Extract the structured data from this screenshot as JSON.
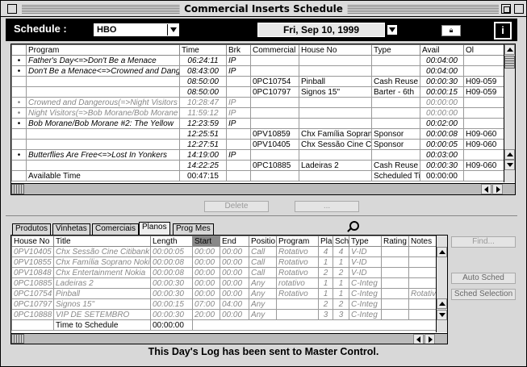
{
  "window": {
    "title": "Commercial Inserts Schedule"
  },
  "header": {
    "schedule_label": "Schedule :",
    "channel": "HBO",
    "date": "Fri, Sep 10, 1999"
  },
  "top_table": {
    "columns": [
      "",
      "Program",
      "Time",
      "Brk",
      "Commercial",
      "House No",
      "Type",
      "Avail",
      "Ol"
    ],
    "rows": [
      {
        "bullet": "•",
        "program": "Father's Day<=>Don't Be a Menace",
        "time": "06:24:11",
        "brk": "IP",
        "commercial": "",
        "house": "",
        "type": "",
        "avail": "00:04:00",
        "ol": "",
        "grey": false
      },
      {
        "bullet": "•",
        "program": "Don't Be a Menace<=>Crowned and Danger",
        "time": "08:43:00",
        "brk": "IP",
        "commercial": "",
        "house": "",
        "type": "",
        "avail": "00:04:00",
        "ol": "",
        "grey": false
      },
      {
        "bullet": "",
        "program": "",
        "time": "08:50:00",
        "brk": "",
        "commercial": "0PC10754",
        "house": "Pinball",
        "type": "Cash Reuse -",
        "avail": "00:00:30",
        "ol": "H09-059",
        "grey": false
      },
      {
        "bullet": "",
        "program": "",
        "time": "08:50:00",
        "brk": "",
        "commercial": "0PC10797",
        "house": "Signos 15\"",
        "type": "Barter - 6th",
        "avail": "00:00:15",
        "ol": "H09-059",
        "grey": false
      },
      {
        "bullet": "•",
        "program": "Crowned and Dangerous(=>Night Visitors",
        "time": "10:28:47",
        "brk": "IP",
        "commercial": "",
        "house": "",
        "type": "",
        "avail": "00:00:00",
        "ol": "",
        "grey": true
      },
      {
        "bullet": "•",
        "program": "Night Visitors(=>Bob Morane/Bob Morane",
        "time": "11:59:12",
        "brk": "IP",
        "commercial": "",
        "house": "",
        "type": "",
        "avail": "00:00:00",
        "ol": "",
        "grey": true
      },
      {
        "bullet": "•",
        "program": "Bob Morane/Bob Morane #2: The Yellow",
        "time": "12:23:59",
        "brk": "IP",
        "commercial": "",
        "house": "",
        "type": "",
        "avail": "00:02:00",
        "ol": "",
        "grey": false
      },
      {
        "bullet": "",
        "program": "",
        "time": "12:25:51",
        "brk": "",
        "commercial": "0PV10859",
        "house": "Chx Família Sopran",
        "type": "Sponsor",
        "avail": "00:00:08",
        "ol": "H09-060",
        "grey": false
      },
      {
        "bullet": "",
        "program": "",
        "time": "12:27:51",
        "brk": "",
        "commercial": "0PV10405",
        "house": "Chx Sessão Cine Cit",
        "type": "Sponsor",
        "avail": "00:00:05",
        "ol": "H09-060",
        "grey": false
      },
      {
        "bullet": "•",
        "program": "Butterflies Are Free<=>Lost In Yonkers",
        "time": "14:19:00",
        "brk": "IP",
        "commercial": "",
        "house": "",
        "type": "",
        "avail": "00:03:00",
        "ol": "",
        "grey": false
      },
      {
        "bullet": "",
        "program": "",
        "time": "14:22:25",
        "brk": "",
        "commercial": "0PC10885",
        "house": "Ladeiras 2",
        "type": "Cash Reuse -",
        "avail": "00:00:30",
        "ol": "H09-060",
        "grey": false
      }
    ],
    "footer": {
      "label": "Available Time",
      "time": "00:47:15",
      "type": "Scheduled Ti",
      "avail": "00:00:00"
    }
  },
  "buttons": {
    "delete": "Delete",
    "ellipsis": "...",
    "find": "Find...",
    "auto_sched": "Auto Sched",
    "sched_selection": "Sched Selection"
  },
  "tabs": [
    "Produtos",
    "Vinhetas",
    "Comerciais",
    "Planos",
    "Prog Mes"
  ],
  "bottom_table": {
    "columns": [
      "House No",
      "Title",
      "Length",
      "Start",
      "End",
      "Positio",
      "Program",
      "Pla",
      "Sch",
      "Type",
      "Rating",
      "Notes"
    ],
    "rows": [
      [
        "0PV10405",
        "Chx Sessão Cine Citibank",
        "00:00:05",
        "00:00",
        "00:00",
        "Call",
        "Rotativo",
        "4",
        "4",
        "V-ID",
        "",
        ""
      ],
      [
        "0PV10855",
        "Chx Família Soprano Nokia",
        "00:00:08",
        "00:00",
        "00:00",
        "Call",
        "Rotativo",
        "1",
        "1",
        "V-ID",
        "",
        ""
      ],
      [
        "0PV10848",
        "Chx Entertainment Nokia",
        "00:00:08",
        "00:00",
        "00:00",
        "Call",
        "Rotativo",
        "2",
        "2",
        "V-ID",
        "",
        ""
      ],
      [
        "0PC10885",
        "Ladeiras 2",
        "00:00:30",
        "00:00",
        "00:00",
        "Any",
        "rotativo",
        "1",
        "1",
        "C-Integ",
        "",
        ""
      ],
      [
        "0PC10754",
        "Pinball",
        "00:00:30",
        "00:00",
        "00:00",
        "Any",
        "Rotativo",
        "1",
        "1",
        "C-Integ",
        "",
        "Rotativ"
      ],
      [
        "0PC10797",
        "Signos 15\"",
        "00:00:15",
        "07:00",
        "04:00",
        "Any",
        "",
        "2",
        "2",
        "C-Integ",
        "",
        ""
      ],
      [
        "0PC10888",
        "VIP DE SETEMBRO",
        "00:00:30",
        "20:00",
        "00:00",
        "Any",
        "",
        "3",
        "3",
        "C-Integ",
        "",
        ""
      ]
    ],
    "footer": {
      "label": "Time to Schedule",
      "time": "00:00:00"
    }
  },
  "status": "This Day's Log has been sent to Master Control."
}
